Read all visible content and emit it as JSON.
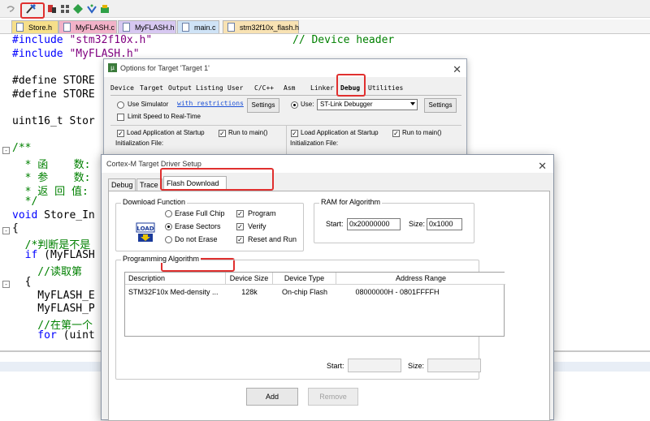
{
  "toolbar": {
    "icons": [
      "undo-icon",
      "options-for-target-icon",
      "manage-project-icon",
      "select-packs-icon",
      "pack-installer-icon",
      "rte-icon",
      "software-packs-icon"
    ]
  },
  "file_tabs": [
    {
      "label": "Store.h",
      "color": "#f6df8a"
    },
    {
      "label": "MyFLASH.c",
      "color": "#f1b2c8"
    },
    {
      "label": "MyFLASH.h",
      "color": "#d7c8f1"
    },
    {
      "label": "main.c",
      "color": "#cfe3f6"
    },
    {
      "label": "stm32f10x_flash.h",
      "color": "#f8e2b3"
    }
  ],
  "code": {
    "line1_kw": "#include ",
    "line1_str": "\"stm32f10x.h\"",
    "line1_comment": "// Device header",
    "line2_kw": "#include ",
    "line2_str": "\"MyFLASH.h\"",
    "line3": "#define STORE",
    "line4": "#define STORE",
    "line5": "uint16_t Stor",
    "line6": "/**",
    "line7": "  * 函    数:",
    "line8": "  * 参    数:",
    "line9": "  * 返 回 值:",
    "line10": "  */",
    "line11_kw": "void",
    "line11": " Store_In",
    "line12": "{",
    "line13": "  /*判断是不是",
    "line14_kw": "  if",
    "line14": " (MyFLASH",
    "line15": "    //读取第",
    "line16": "  {",
    "line17": "    MyFLASH_E",
    "line18": "    MyFLASH_P",
    "line19": "    //在第一个",
    "line20_kw": "    for",
    "line20": " (uint"
  },
  "options_dialog": {
    "title": "Options for Target 'Target 1'",
    "tabs": [
      "Device",
      "Target",
      "Output",
      "Listing",
      "User",
      "C/C++",
      "Asm",
      "Linker",
      "Debug",
      "Utilities"
    ],
    "use_simulator": "Use Simulator",
    "with_restrictions": "with restrictions",
    "settings": "Settings",
    "limit_speed": "Limit Speed to Real-Time",
    "use": "Use:",
    "debugger": "ST-Link Debugger",
    "load_app": "Load Application at Startup",
    "run_to_main": "Run to main()",
    "init_file": "Initialization File:"
  },
  "driver_dialog": {
    "title": "Cortex-M Target Driver Setup",
    "tabs": [
      "Debug",
      "Trace",
      "Flash Download"
    ],
    "download_function": {
      "label": "Download Function",
      "load_icon_text": "LOAD",
      "erase_full_chip": "Erase Full Chip",
      "erase_sectors": "Erase Sectors",
      "do_not_erase": "Do not Erase",
      "program": "Program",
      "verify": "Verify",
      "reset_and_run": "Reset and Run"
    },
    "ram": {
      "label": "RAM for Algorithm",
      "start_label": "Start:",
      "start_value": "0x20000000",
      "size_label": "Size:",
      "size_value": "0x1000"
    },
    "programming_algorithm": {
      "label": "Programming Algorithm",
      "columns": [
        "Description",
        "Device Size",
        "Device Type",
        "Address Range"
      ],
      "rows": [
        {
          "description": "STM32F10x Med-density ...",
          "size": "128k",
          "type": "On-chip Flash",
          "range": "08000000H - 0801FFFFH"
        }
      ],
      "start_label": "Start:",
      "size_label": "Size:"
    },
    "add_button": "Add",
    "remove_button": "Remove"
  }
}
